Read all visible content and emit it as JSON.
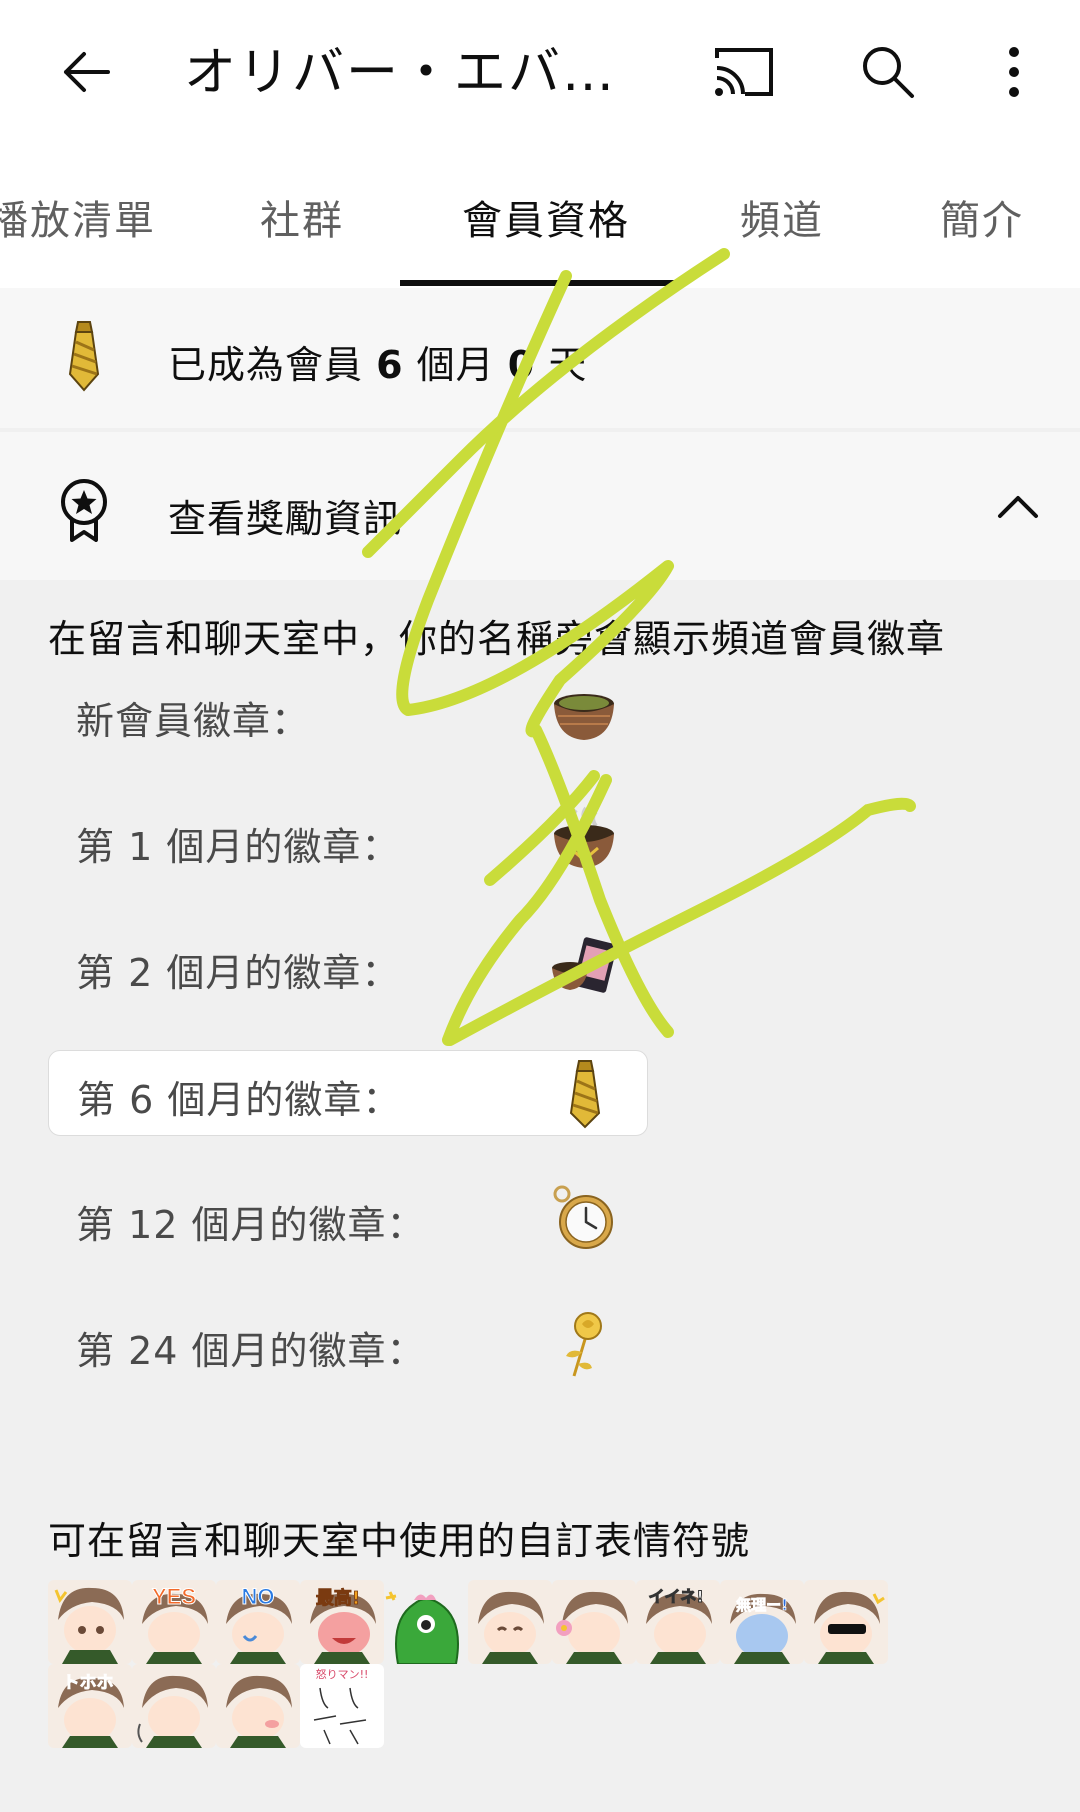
{
  "topbar": {
    "title": "オリバー・エバ…",
    "back_icon": "arrow-left-icon",
    "cast_icon": "cast-icon",
    "search_icon": "search-icon",
    "more_icon": "more-vertical-icon"
  },
  "tabs": [
    {
      "label": "播放清單"
    },
    {
      "label": "社群"
    },
    {
      "label": "會員資格",
      "active": true
    },
    {
      "label": "頻道"
    },
    {
      "label": "簡介"
    }
  ],
  "membership": {
    "status_prefix": "已成為會員 ",
    "months": "6",
    "months_unit": " 個月 ",
    "days": "0",
    "days_unit": " 天",
    "rewards_label": "查看獎勵資訊"
  },
  "badges_section": {
    "description": "在留言和聊天室中，你的名稱旁會顯示頻道會員徽章",
    "items": [
      {
        "label": "新會員徽章：",
        "icon": "bowl-badge-icon"
      },
      {
        "label": "第 1 個月的徽章：",
        "icon": "steaming-bowl-badge-icon"
      },
      {
        "label": "第 2 個月的徽章：",
        "icon": "bowl-book-badge-icon"
      },
      {
        "label": "第 6 個月的徽章：",
        "icon": "necktie-badge-icon",
        "current": true
      },
      {
        "label": "第 12 個月的徽章：",
        "icon": "pocket-watch-badge-icon"
      },
      {
        "label": "第 24 個月的徽章：",
        "icon": "golden-rose-badge-icon"
      }
    ]
  },
  "emoji_section": {
    "title": "可在留言和聊天室中使用的自訂表情符號",
    "emojis": [
      {
        "name": "sparkle-face-emoji",
        "text": ""
      },
      {
        "name": "yes-emoji",
        "text": "YES"
      },
      {
        "name": "no-emoji",
        "text": "NO"
      },
      {
        "name": "saikou-emoji",
        "text": "最高!"
      },
      {
        "name": "green-monster-emoji",
        "text": ""
      },
      {
        "name": "smile-emoji",
        "text": ""
      },
      {
        "name": "flower-emoji",
        "text": ""
      },
      {
        "name": "iine-emoji",
        "text": "イイネ!"
      },
      {
        "name": "muri-emoji",
        "text": "無理ー!"
      },
      {
        "name": "sunglasses-emoji",
        "text": ""
      },
      {
        "name": "tohoho-emoji",
        "text": "トホホ"
      },
      {
        "name": "wave-emoji",
        "text": ""
      },
      {
        "name": "pout-emoji",
        "text": ""
      },
      {
        "name": "sketch-emoji",
        "text": "怒りマン!!"
      }
    ]
  },
  "colors": {
    "header_bg": "#ffffff",
    "content_bg": "#f0f0f0",
    "tab_active": "#0f0f0f",
    "tab_inactive": "#606060",
    "scribble": "#c9dc3a"
  }
}
